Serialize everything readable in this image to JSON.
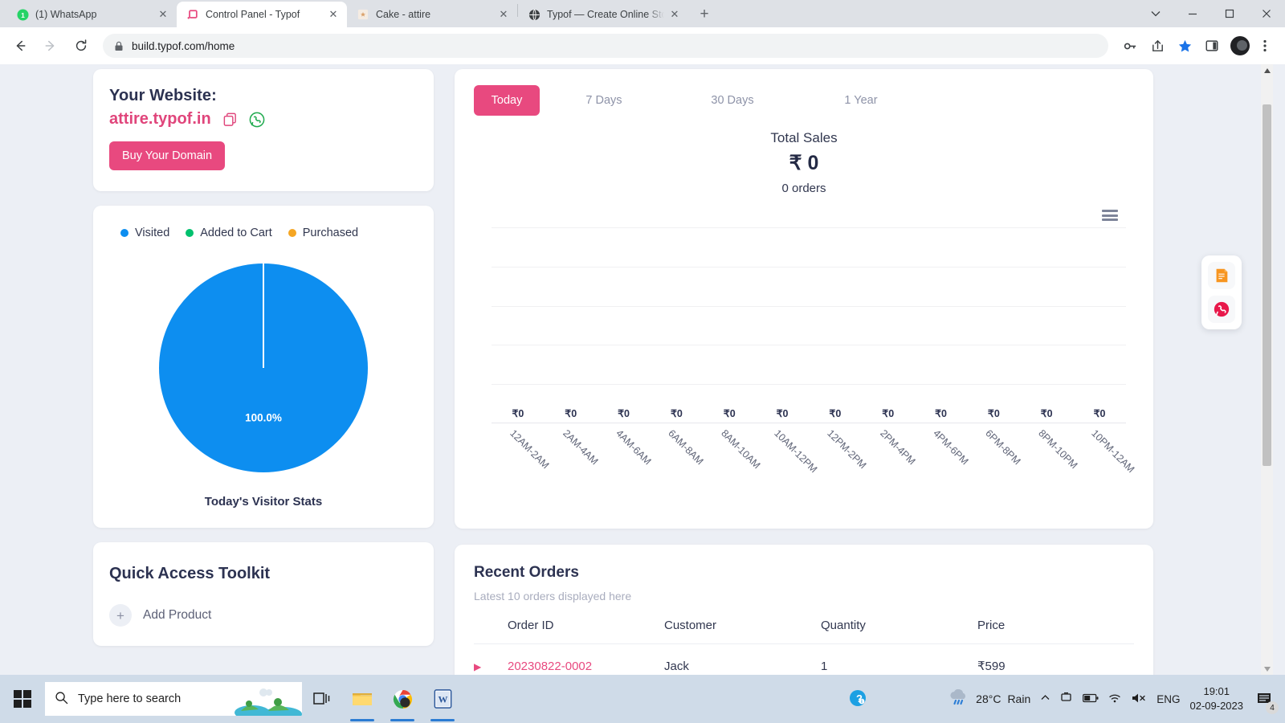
{
  "browser": {
    "tabs": [
      {
        "title": "(1) WhatsApp",
        "favicon": "whatsapp-badge-icon",
        "active": false
      },
      {
        "title": "Control Panel - Typof",
        "favicon": "typof-icon",
        "active": true
      },
      {
        "title": "Cake - attire",
        "favicon": "cake-icon",
        "active": false
      },
      {
        "title": "Typof — Create Online Store - D",
        "favicon": "globe-icon",
        "active": false
      }
    ],
    "new_tab_label": "+",
    "close_label": "✕",
    "window_controls": {
      "minimize": "—",
      "maximize": "▢",
      "close": "✕",
      "tab_search": "⌄"
    },
    "nav": {
      "back": "back-arrow-icon",
      "forward": "forward-arrow-icon",
      "reload": "reload-icon"
    },
    "address": {
      "url": "build.typof.com/home",
      "lock": "lock-icon"
    },
    "toolbar_icons": [
      "key-icon",
      "share-icon",
      "bookmark-star-icon",
      "side-panel-icon",
      "profile-avatar",
      "kebab-menu-icon"
    ]
  },
  "website_card": {
    "heading": "Your Website:",
    "domain": "attire.typof.in",
    "copy_icon": "copy-icon",
    "whatsapp_icon": "whatsapp-icon",
    "buy_button": "Buy Your Domain"
  },
  "visitor_card": {
    "title": "Today's Visitor Stats",
    "legend": [
      {
        "label": "Visited",
        "color": "#0d8ef0"
      },
      {
        "label": "Added to Cart",
        "color": "#00c16e"
      },
      {
        "label": "Purchased",
        "color": "#f5a623"
      }
    ],
    "slice_label": "100.0%"
  },
  "quick_access": {
    "title": "Quick Access Toolkit",
    "items": [
      {
        "label": "Add Product",
        "icon": "plus-icon"
      }
    ]
  },
  "sales": {
    "ranges": [
      {
        "label": "Today",
        "active": true
      },
      {
        "label": "7 Days",
        "active": false
      },
      {
        "label": "30 Days",
        "active": false
      },
      {
        "label": "1 Year",
        "active": false
      }
    ],
    "total_sales_label": "Total Sales",
    "total_sales_amount": "₹ 0",
    "orders_count_label": "0 orders",
    "menu_icon": "hamburger-menu-icon"
  },
  "orders": {
    "title": "Recent Orders",
    "subtitle": "Latest 10 orders displayed here",
    "columns": [
      "Order ID",
      "Customer",
      "Quantity",
      "Price"
    ],
    "rows": [
      {
        "caret": "▶",
        "order_id": "20230822-0002",
        "customer": "Jack",
        "quantity": "1",
        "price": "₹599"
      }
    ]
  },
  "floating_actions": [
    {
      "name": "notes-icon"
    },
    {
      "name": "whatsapp-support-icon"
    }
  ],
  "taskbar": {
    "start_icon": "windows-start-icon",
    "search_placeholder": "Type here to search",
    "apps": [
      "task-view-icon",
      "file-explorer-icon",
      "chrome-icon",
      "word-icon"
    ],
    "help_icon": "help-icon",
    "weather": {
      "temperature": "28°C",
      "condition": "Rain",
      "icon": "rain-icon"
    },
    "tray_icons": [
      "chevron-up-icon",
      "onedrive-icon",
      "battery-icon",
      "wifi-icon",
      "volume-muted-icon"
    ],
    "language": "ENG",
    "time": "19:01",
    "date": "02-09-2023",
    "notification_count": "4"
  },
  "chart_data": {
    "type": "bar",
    "title": "Total Sales",
    "subtitle": "0 orders",
    "categories": [
      "12AM-2AM",
      "2AM-4AM",
      "4AM-6AM",
      "6AM-8AM",
      "8AM-10AM",
      "10AM-12PM",
      "12PM-2PM",
      "2PM-4PM",
      "4PM-6PM",
      "6PM-8PM",
      "8PM-10PM",
      "10PM-12AM"
    ],
    "values": [
      0,
      0,
      0,
      0,
      0,
      0,
      0,
      0,
      0,
      0,
      0,
      0
    ],
    "data_labels": [
      "₹0",
      "₹0",
      "₹0",
      "₹0",
      "₹0",
      "₹0",
      "₹0",
      "₹0",
      "₹0",
      "₹0",
      "₹0",
      "₹0"
    ],
    "xlabel": "",
    "ylabel": "",
    "ylim": [
      0,
      5
    ],
    "grid": true,
    "gridline_count": 5,
    "legend": false
  },
  "pie_chart_data": {
    "type": "pie",
    "title": "Today's Visitor Stats",
    "labels": [
      "Visited",
      "Added to Cart",
      "Purchased"
    ],
    "values": [
      100.0,
      0,
      0
    ],
    "colors": [
      "#0d8ef0",
      "#00c16e",
      "#f5a623"
    ],
    "data_labels": [
      "100.0%"
    ],
    "legend": "top"
  }
}
